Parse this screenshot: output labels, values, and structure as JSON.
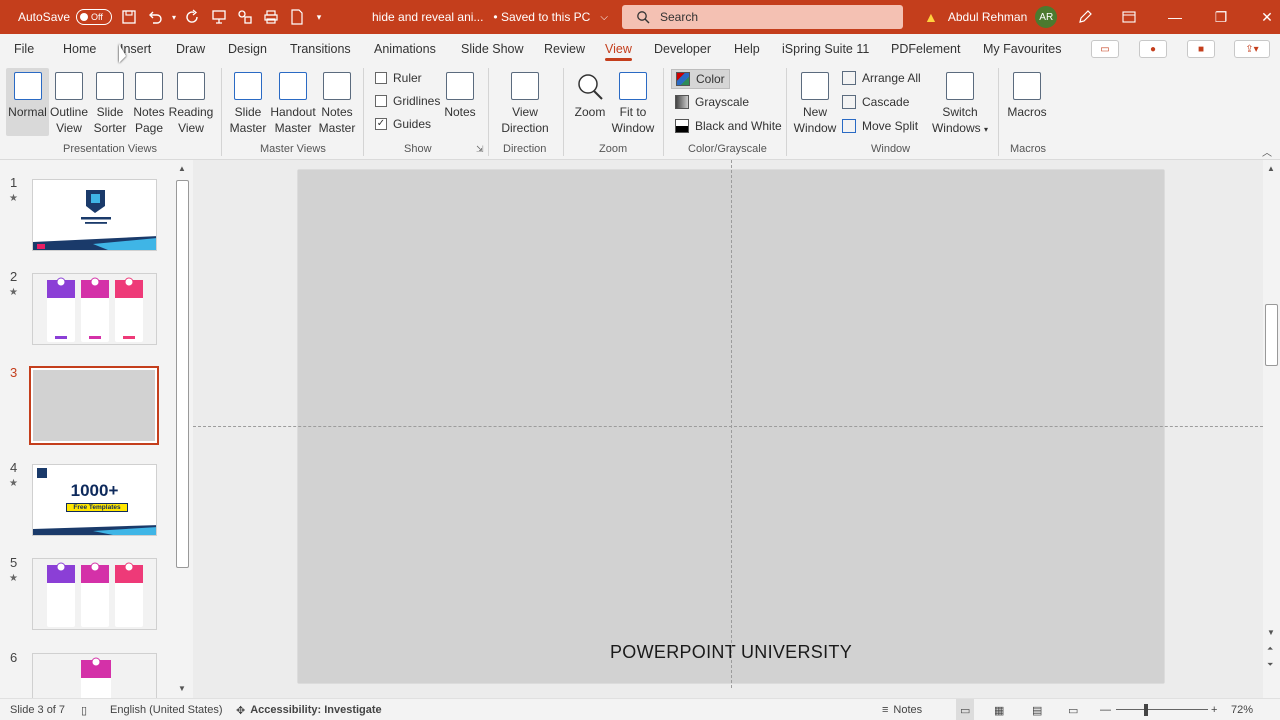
{
  "titlebar": {
    "autosave_label": "AutoSave",
    "autosave_state": "Off",
    "doc_title": "hide and reveal ani...",
    "save_status": "• Saved to this PC",
    "search_placeholder": "Search",
    "user_name": "Abdul Rehman",
    "user_initials": "AR",
    "accent": "#c43e1c"
  },
  "tabs": [
    {
      "label": "File"
    },
    {
      "label": "Home"
    },
    {
      "label": "Insert"
    },
    {
      "label": "Draw"
    },
    {
      "label": "Design"
    },
    {
      "label": "Transitions"
    },
    {
      "label": "Animations"
    },
    {
      "label": "Slide Show"
    },
    {
      "label": "Review"
    },
    {
      "label": "View"
    },
    {
      "label": "Developer"
    },
    {
      "label": "Help"
    },
    {
      "label": "iSpring Suite 11"
    },
    {
      "label": "PDFelement"
    },
    {
      "label": "My Favourites"
    }
  ],
  "ribbon": {
    "presentation_views": {
      "group": "Presentation Views",
      "normal": "Normal",
      "outline": [
        "Outline",
        "View"
      ],
      "sorter": [
        "Slide",
        "Sorter"
      ],
      "notes_page": [
        "Notes",
        "Page"
      ],
      "reading": [
        "Reading",
        "View"
      ]
    },
    "master_views": {
      "group": "Master Views",
      "slide": [
        "Slide",
        "Master"
      ],
      "handout": [
        "Handout",
        "Master"
      ],
      "notes": [
        "Notes",
        "Master"
      ]
    },
    "show": {
      "group": "Show",
      "ruler": "Ruler",
      "gridlines": "Gridlines",
      "guides": "Guides",
      "notes": "Notes"
    },
    "direction": {
      "group": "Direction",
      "view": "View",
      "direction": "Direction"
    },
    "zoom": {
      "group": "Zoom",
      "zoom": "Zoom",
      "fit": [
        "Fit to",
        "Window"
      ]
    },
    "color": {
      "group": "Color/Grayscale",
      "color": "Color",
      "grayscale": "Grayscale",
      "bw": "Black and White"
    },
    "window": {
      "group": "Window",
      "new": [
        "New",
        "Window"
      ],
      "arrange": "Arrange All",
      "cascade": "Cascade",
      "move_split": "Move Split",
      "switch": [
        "Switch",
        "Windows"
      ]
    },
    "macros": {
      "group": "Macros",
      "label": "Macros"
    }
  },
  "thumbnails": [
    {
      "num": "1",
      "star": "★"
    },
    {
      "num": "2",
      "star": "★"
    },
    {
      "num": "3",
      "star": ""
    },
    {
      "num": "4",
      "star": "★",
      "title": "1000+",
      "subtitle": "Free Templates"
    },
    {
      "num": "5",
      "star": "★"
    },
    {
      "num": "6",
      "star": ""
    }
  ],
  "slide": {
    "text": "POWERPOINT UNIVERSITY"
  },
  "status": {
    "slide_info": "Slide 3 of 7",
    "language": "English (United States)",
    "accessibility": "Accessibility: Investigate",
    "notes": "Notes",
    "zoom": "72%"
  }
}
